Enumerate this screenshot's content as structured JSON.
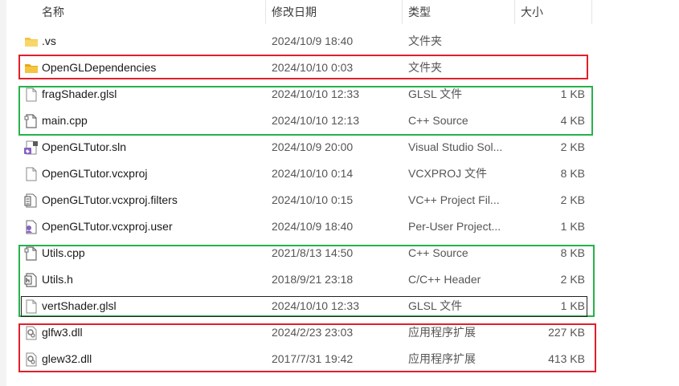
{
  "header": {
    "name": "名称",
    "date": "修改日期",
    "type": "类型",
    "size": "大小"
  },
  "files": [
    {
      "name": ".vs",
      "date": "2024/10/9 18:40",
      "type": "文件夹",
      "size": "",
      "icon": "folder-icon"
    },
    {
      "name": "OpenGLDependencies",
      "date": "2024/10/10 0:03",
      "type": "文件夹",
      "size": "",
      "icon": "folder-icon"
    },
    {
      "name": "fragShader.glsl",
      "date": "2024/10/10 12:33",
      "type": "GLSL 文件",
      "size": "1 KB",
      "icon": "blank-file-icon"
    },
    {
      "name": "main.cpp",
      "date": "2024/10/10 12:13",
      "type": "C++ Source",
      "size": "4 KB",
      "icon": "cpp-file-icon"
    },
    {
      "name": "OpenGLTutor.sln",
      "date": "2024/10/9 20:00",
      "type": "Visual Studio Sol...",
      "size": "2 KB",
      "icon": "visual-studio-solution-icon"
    },
    {
      "name": "OpenGLTutor.vcxproj",
      "date": "2024/10/10 0:14",
      "type": "VCXPROJ 文件",
      "size": "8 KB",
      "icon": "blank-file-icon"
    },
    {
      "name": "OpenGLTutor.vcxproj.filters",
      "date": "2024/10/10 0:15",
      "type": "VC++ Project Fil...",
      "size": "2 KB",
      "icon": "project-filters-icon"
    },
    {
      "name": "OpenGLTutor.vcxproj.user",
      "date": "2024/10/9 18:40",
      "type": "Per-User Project...",
      "size": "1 KB",
      "icon": "project-user-icon"
    },
    {
      "name": "Utils.cpp",
      "date": "2021/8/13 14:50",
      "type": "C++ Source",
      "size": "8 KB",
      "icon": "cpp-file-icon"
    },
    {
      "name": "Utils.h",
      "date": "2018/9/21 23:18",
      "type": "C/C++ Header",
      "size": "2 KB",
      "icon": "header-file-icon"
    },
    {
      "name": "vertShader.glsl",
      "date": "2024/10/10 12:33",
      "type": "GLSL 文件",
      "size": "1 KB",
      "icon": "blank-file-icon"
    },
    {
      "name": "glfw3.dll",
      "date": "2024/2/23 23:03",
      "type": "应用程序扩展",
      "size": "227 KB",
      "icon": "dll-file-icon"
    },
    {
      "name": "glew32.dll",
      "date": "2017/7/31 19:42",
      "type": "应用程序扩展",
      "size": "413 KB",
      "icon": "dll-file-icon"
    }
  ],
  "colors": {
    "highlight_red": "#e0202b",
    "highlight_green": "#26b24a",
    "folder_yellow": "#f4c542"
  }
}
